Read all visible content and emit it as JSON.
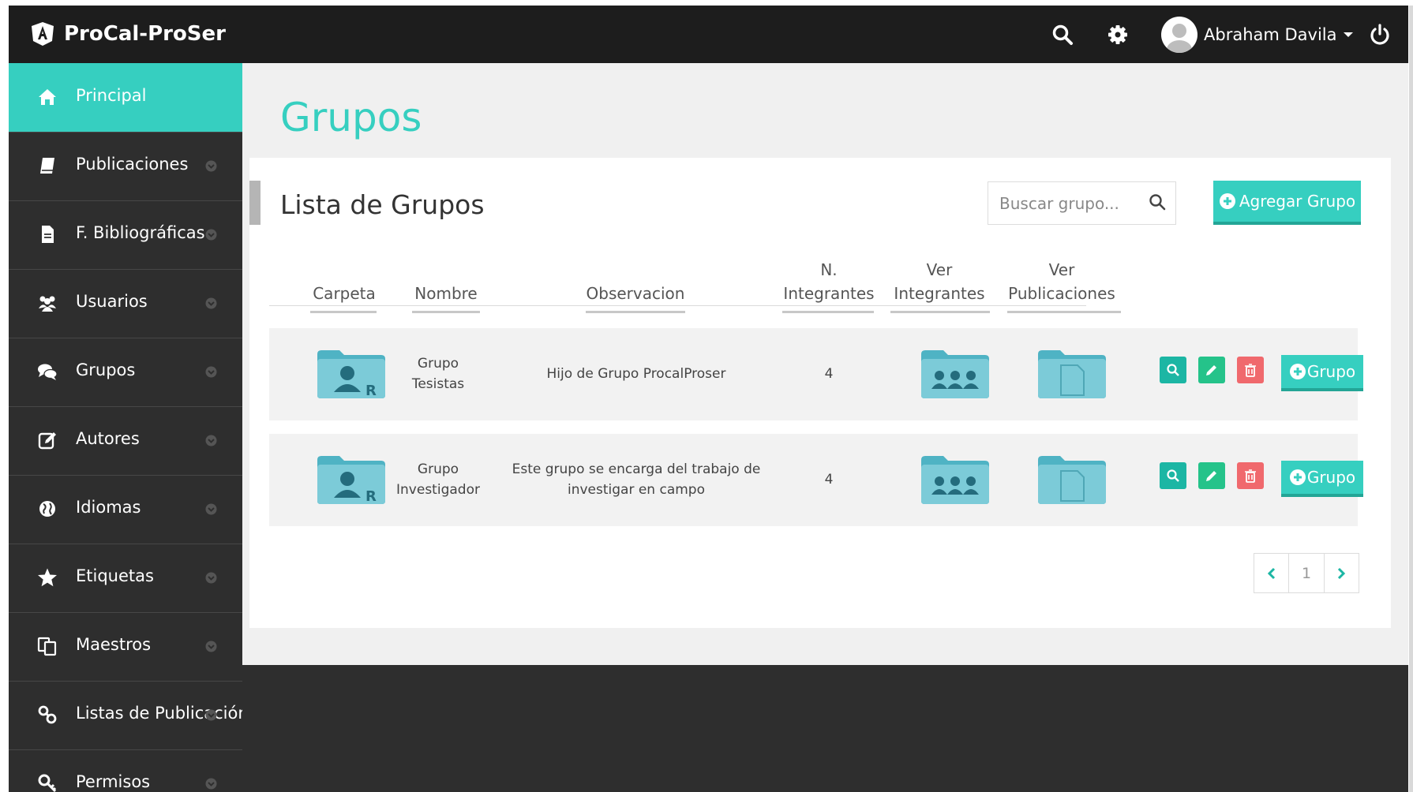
{
  "app": {
    "brand": "ProCal-ProSer"
  },
  "header": {
    "user_name": "Abraham Davila"
  },
  "sidebar": {
    "items": [
      {
        "label": "Principal",
        "icon": "home-icon",
        "active": true
      },
      {
        "label": "Publicaciones",
        "icon": "book-icon"
      },
      {
        "label": "F. Bibliográficas",
        "icon": "file-icon"
      },
      {
        "label": "Usuarios",
        "icon": "users-icon"
      },
      {
        "label": "Grupos",
        "icon": "comments-icon"
      },
      {
        "label": "Autores",
        "icon": "edit-icon"
      },
      {
        "label": "Idiomas",
        "icon": "globe-icon"
      },
      {
        "label": "Etiquetas",
        "icon": "star-icon"
      },
      {
        "label": "Maestros",
        "icon": "copy-icon"
      },
      {
        "label": "Listas de Publicación",
        "icon": "link-icon"
      },
      {
        "label": "Permisos",
        "icon": "key-icon"
      }
    ]
  },
  "main": {
    "page_title": "Grupos",
    "card_title": "Lista de Grupos",
    "search_placeholder": "Buscar grupo...",
    "add_button": "Agregar Grupo",
    "columns": {
      "carpeta": "Carpeta",
      "nombre": "Nombre",
      "observacion": "Observacion",
      "integrantes_1": "N.",
      "integrantes_2": "Integrantes",
      "ver_integrantes_1": "Ver",
      "ver_integrantes_2": "Integrantes",
      "ver_pub_1": "Ver",
      "ver_pub_2": "Publicaciones"
    },
    "rows": [
      {
        "name_1": "Grupo",
        "name_2": "Tesistas",
        "obs_1": "Hijo de Grupo ProcalProser",
        "obs_2": "",
        "count": "4",
        "group_button": "Grupo"
      },
      {
        "name_1": "Grupo",
        "name_2": "Investigador",
        "obs_1": "Este grupo se encarga del trabajo de",
        "obs_2": "investigar en campo",
        "count": "4",
        "group_button": "Grupo"
      }
    ],
    "pagination": {
      "current": "1"
    }
  },
  "colors": {
    "accent": "#36cfc0",
    "topbar": "#1d1d1d",
    "sidebar": "#2e2e2e",
    "folder": "#6cc4d0",
    "delete": "#f0696d"
  }
}
